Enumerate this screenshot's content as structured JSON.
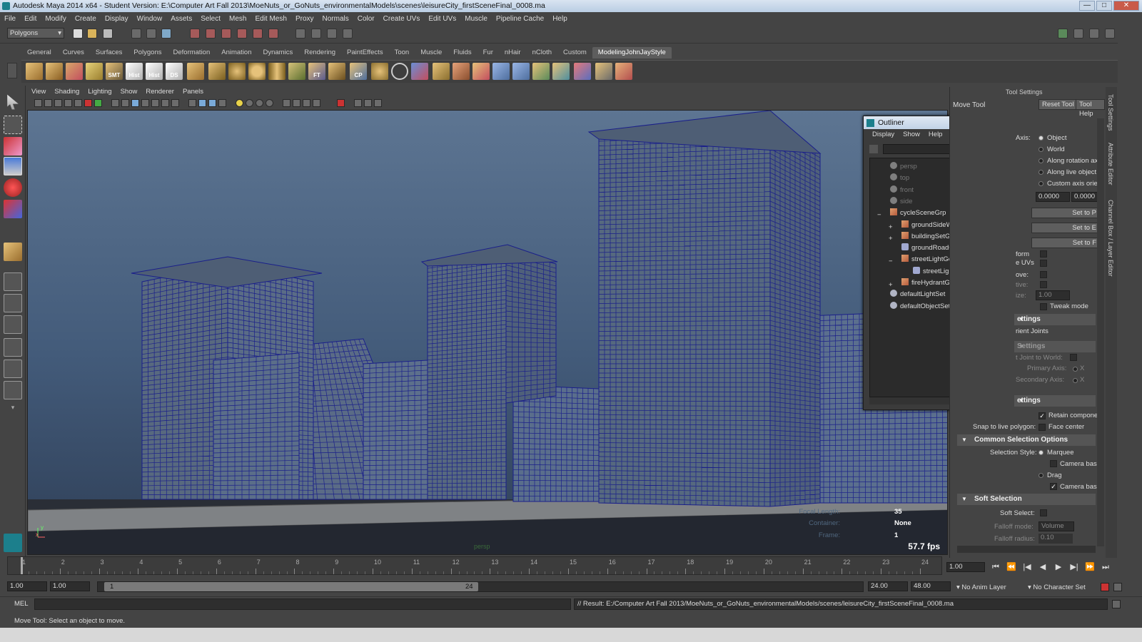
{
  "window": {
    "title": "Autodesk Maya 2014 x64 - Student Version: E:\\Computer Art Fall 2013\\MoeNuts_or_GoNuts_environmentalModels\\scenes\\leisureCity_firstSceneFinal_0008.ma",
    "minimize": "—",
    "maximize": "□",
    "close": "✕"
  },
  "menubar": [
    "File",
    "Edit",
    "Modify",
    "Create",
    "Display",
    "Window",
    "Assets",
    "Select",
    "Mesh",
    "Edit Mesh",
    "Proxy",
    "Normals",
    "Color",
    "Create UVs",
    "Edit UVs",
    "Muscle",
    "Pipeline Cache",
    "Help"
  ],
  "statusline": {
    "mode": "Polygons"
  },
  "shelf": {
    "tabs": [
      "General",
      "Curves",
      "Surfaces",
      "Polygons",
      "Deformation",
      "Animation",
      "Dynamics",
      "Rendering",
      "PaintEffects",
      "Toon",
      "Muscle",
      "Fluids",
      "Fur",
      "nHair",
      "nCloth",
      "Custom",
      "ModelingJohnJayStyle"
    ],
    "active_tab": "ModelingJohnJayStyle",
    "labels": {
      "smt": "SMT",
      "hist1": "Hist",
      "hist2": "Hist",
      "ds": "DS",
      "ft": "FT",
      "cp": "CP"
    }
  },
  "viewport": {
    "menu": [
      "View",
      "Shading",
      "Lighting",
      "Show",
      "Renderer",
      "Panels"
    ],
    "hud": {
      "focal_label": "Focal Length:",
      "focal_value": "35",
      "container_label": "Container:",
      "container_value": "None",
      "frame_label": "Frame:",
      "frame_value": "1",
      "fps": "57.7 fps",
      "camera": "persp",
      "axis_y": "y",
      "axis_x": "x"
    },
    "colors": {
      "sky_top": "#5d7592",
      "sky_bottom": "#2f3f57",
      "wire": "#1a1f8a",
      "ground": "#7f8285"
    }
  },
  "outliner": {
    "title": "Outliner",
    "menu": [
      "Display",
      "Show",
      "Help"
    ],
    "items": [
      {
        "name": "persp",
        "kind": "cam",
        "level": 0,
        "dim": true
      },
      {
        "name": "top",
        "kind": "cam",
        "level": 0,
        "dim": true
      },
      {
        "name": "front",
        "kind": "cam",
        "level": 0,
        "dim": true
      },
      {
        "name": "side",
        "kind": "cam",
        "level": 0,
        "dim": true
      },
      {
        "name": "cycleSceneGrp",
        "kind": "grp",
        "level": 0,
        "expander": "−"
      },
      {
        "name": "groundSideWalkGrp",
        "kind": "grp",
        "level": 1,
        "expander": "+"
      },
      {
        "name": "buildingSetGrp",
        "kind": "grp",
        "level": 1,
        "expander": "+"
      },
      {
        "name": "groundRoadGeo",
        "kind": "mesh",
        "level": 1
      },
      {
        "name": "streetLightGeoGrp",
        "kind": "grp",
        "level": 1,
        "expander": "−"
      },
      {
        "name": "streetLightBaseGeo",
        "kind": "mesh",
        "level": 2
      },
      {
        "name": "fireHydrantGeoGrp",
        "kind": "grp",
        "level": 1,
        "expander": "+"
      },
      {
        "name": "defaultLightSet",
        "kind": "set",
        "level": 0
      },
      {
        "name": "defaultObjectSet",
        "kind": "set",
        "level": 0
      }
    ]
  },
  "toolsettings": {
    "header": "Tool Settings",
    "tool_name": "Move Tool",
    "reset_tool": "Reset Tool",
    "tool_help": "Tool Help",
    "axis_label": "Axis:",
    "axis_options": [
      "Object",
      "World",
      "Along rotation ax",
      "Along live object",
      "Custom axis orier"
    ],
    "axis_value1": "0.0000",
    "axis_value2": "0.0000",
    "set_buttons": [
      "Set to P",
      "Set to E",
      "Set to F"
    ],
    "form_label": "form",
    "uvs_label": "e UVs",
    "move_label": "ove:",
    "tive_label": "tive:",
    "size_label": "ize:",
    "size_value": "1.00",
    "tweak_mode": "Tweak mode",
    "sec_settings1": "ettings",
    "orient_joints": "rient Joints",
    "sec_settings2": "Settings",
    "joint_to_world": "t Joint to World:",
    "primary_axis": "Primary Axis:",
    "secondary_axis": "Secondary Axis:",
    "axis_x": "X",
    "sec_settings3": "ettings",
    "retain_component": "Retain componer",
    "snap_live_polygon": "Snap to live polygon:",
    "face_center": "Face center",
    "common_selection": "Common Selection Options",
    "selection_style": "Selection Style:",
    "marquee": "Marquee",
    "camera_based1": "Camera base",
    "drag": "Drag",
    "camera_based2": "Camera base",
    "soft_selection": "Soft Selection",
    "soft_select": "Soft Select:",
    "falloff_mode": "Falloff mode:",
    "falloff_mode_value": "Volume",
    "falloff_radius": "Falloff radius:",
    "falloff_radius_value": "0.10"
  },
  "side_tabs": [
    "Tool Settings",
    "Attribute Editor",
    "Channel Box / Layer Editor"
  ],
  "timeslider": {
    "ticks": [
      "1",
      "2",
      "3",
      "4",
      "5",
      "6",
      "7",
      "8",
      "9",
      "10",
      "11",
      "12",
      "13",
      "14",
      "15",
      "16",
      "17",
      "18",
      "19",
      "20",
      "21",
      "22",
      "23",
      "24"
    ],
    "current_time": "1.00",
    "controls": [
      "⏮",
      "⏪",
      "|◀",
      "◀",
      "▶",
      "▶|",
      "⏩",
      "⏭"
    ]
  },
  "range": {
    "start": "1.00",
    "playback_start": "1.00",
    "handle_start": "1",
    "handle_end": "24",
    "playback_end": "24.00",
    "end": "48.00",
    "anim_layer": "No Anim Layer",
    "char_set": "No Character Set"
  },
  "cmdline": {
    "label": "MEL",
    "result": "// Result: E:/Computer Art Fall 2013/MoeNuts_or_GoNuts_environmentalModels/scenes/leisureCity_firstSceneFinal_0008.ma"
  },
  "helpline": "Move Tool: Select an object to move."
}
